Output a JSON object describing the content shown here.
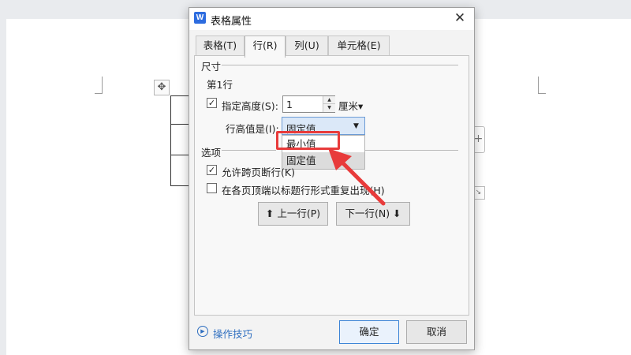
{
  "dialog": {
    "title": "表格属性",
    "app_icon": "W",
    "close_glyph": "✕"
  },
  "tabs": [
    {
      "label": "表格(T)",
      "active": false
    },
    {
      "label": "行(R)",
      "active": true
    },
    {
      "label": "列(U)",
      "active": false
    },
    {
      "label": "单元格(E)",
      "active": false
    }
  ],
  "size_section": {
    "label": "尺寸",
    "row_label": "第1行",
    "specify_height": {
      "label": "指定高度(S):",
      "checked": true
    },
    "height_value": "1",
    "unit": "厘米▾",
    "row_height_is_label": "行高值是(I):",
    "row_height_selected": "固定值",
    "dropdown_options": [
      {
        "label": "最小值",
        "selected": false
      },
      {
        "label": "固定值",
        "selected": true
      }
    ]
  },
  "options_section": {
    "label": "选项",
    "allow_break": {
      "label": "允许跨页断行(K)",
      "checked": true
    },
    "repeat_header": {
      "label": "在各页顶端以标题行形式重复出现(H)",
      "checked": false
    }
  },
  "nav_buttons": {
    "prev": "⬆ 上一行(P)",
    "next": "下一行(N) ⬇"
  },
  "footer": {
    "tips": "操作技巧",
    "ok": "确定",
    "cancel": "取消"
  },
  "colors": {
    "annotation_red": "#e83b3b",
    "accent_blue": "#2f6fc0"
  },
  "icons": {
    "move_handle": "move-icon",
    "add_column": "plus-icon",
    "resize": "resize-icon",
    "tips": "play-circle-icon"
  }
}
